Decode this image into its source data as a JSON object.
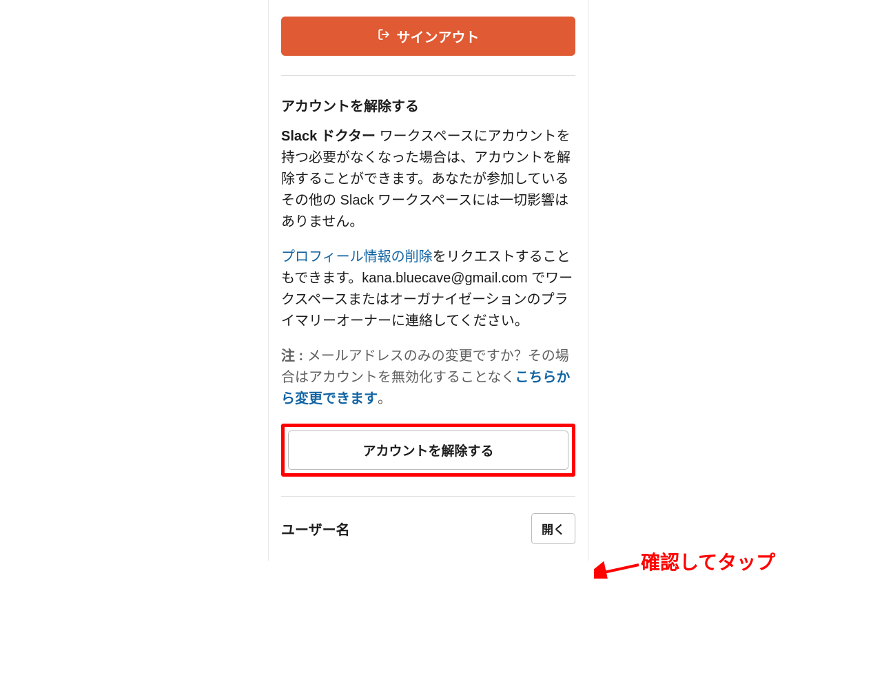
{
  "signout": {
    "label": "サインアウト"
  },
  "deactivate": {
    "title": "アカウントを解除する",
    "workspace_name": "Slack ドクター",
    "desc_suffix": " ワークスペースにアカウントを持つ必要がなくなった場合は、アカウントを解除することができます。あなたが参加しているその他の Slack ワークスペースには一切影響はありません。",
    "profile_link": "プロフィール情報の削除",
    "desc2_part1": "をリクエストすることもできます。",
    "email": "kana.bluecave@gmail.com",
    "desc2_part2": " でワークスペースまたはオーガナイゼーションのプライマリーオーナーに連絡してください。",
    "note_label": "注 :",
    "note_text": " メールアドレスのみの変更ですか？その場合はアカウントを無効化することなく",
    "note_link": "こちらから変更できます",
    "note_suffix": "。",
    "button": "アカウントを解除する"
  },
  "username": {
    "label": "ユーザー名",
    "open_button": "開く"
  },
  "annotation": {
    "text": "確認してタップ"
  }
}
